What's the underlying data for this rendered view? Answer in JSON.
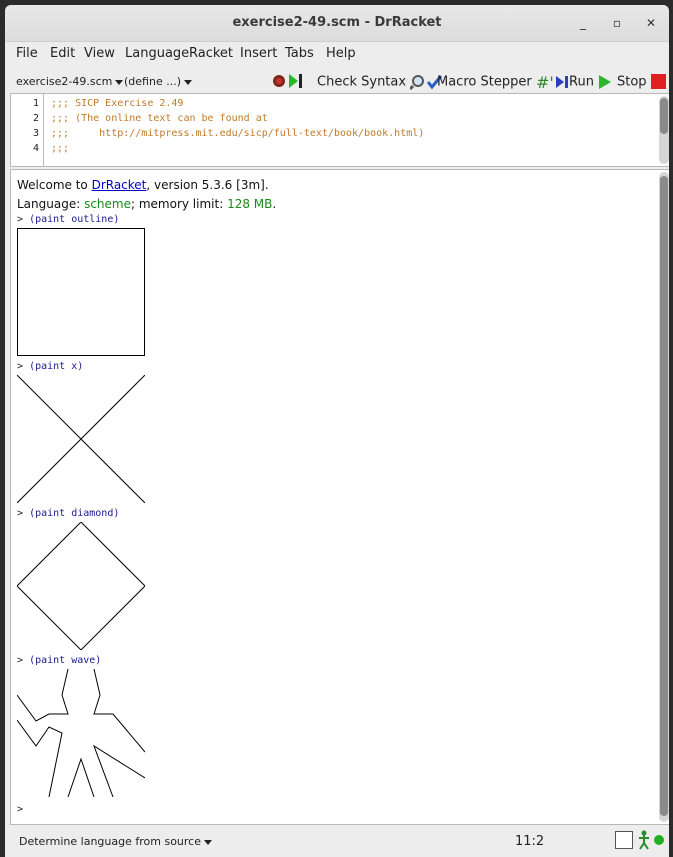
{
  "window": {
    "title": "exercise2-49.scm - DrRacket",
    "minimize": "_",
    "maximize": "▫",
    "close": "✕"
  },
  "menu": [
    "File",
    "Edit",
    "View",
    "Language",
    "Racket",
    "Insert",
    "Tabs",
    "Help"
  ],
  "toolbar": {
    "file_dropdown": "exercise2-49.scm",
    "define_dropdown": "(define ...)",
    "check_syntax": "Check Syntax",
    "macro_stepper": "Macro Stepper",
    "run": "Run",
    "stop": "Stop"
  },
  "editor": {
    "lines": [
      {
        "num": "1",
        "text": ";;; SICP Exercise 2.49"
      },
      {
        "num": "2",
        "text": ";;; (The online text can be found at"
      },
      {
        "num": "3",
        "text": ";;;     http://mitpress.mit.edu/sicp/full-text/book/book.html)"
      },
      {
        "num": "4",
        "text": ";;;"
      }
    ]
  },
  "repl": {
    "welcome_prefix": "Welcome to ",
    "welcome_link": "DrRacket",
    "welcome_suffix": ", version 5.3.6 [3m].",
    "language_prefix": "Language: ",
    "language_name": "scheme",
    "language_mid": "; memory limit: ",
    "memory": "128 MB",
    "language_end": ".",
    "prompt": ">",
    "commands": [
      "(paint outline)",
      "(paint x)",
      "(paint diamond)",
      "(paint wave)"
    ]
  },
  "status": {
    "language": "Determine language from source",
    "position": "11:2"
  },
  "colors": {
    "stop": "#e02020",
    "run": "#2ab82a",
    "comment": "#c07a2a"
  }
}
